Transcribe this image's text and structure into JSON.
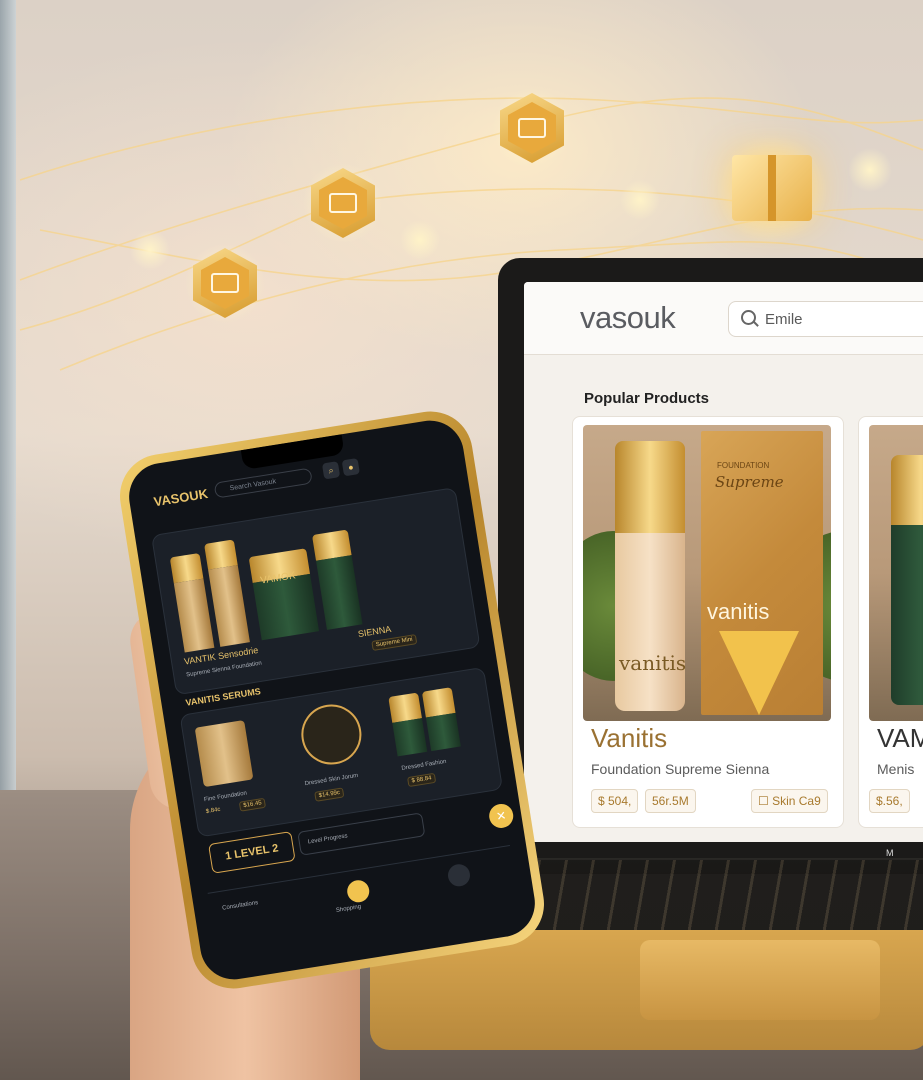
{
  "scene": {
    "icons": [
      "mail-icon",
      "mail-icon",
      "card-icon",
      "gift-icon"
    ],
    "accent": "#d8a64f"
  },
  "laptop": {
    "logo": "vasouk",
    "search_placeholder": "Emile",
    "section_title": "Popular Products",
    "corner_label": "M",
    "cards": [
      {
        "name": "Vanitis",
        "subtitle": "Foundation Supreme Sienna",
        "bottle_label": "vanitis",
        "box_brand": "vanitis",
        "box_top": "FOUNDATION",
        "box_script": "Supreme",
        "chips": [
          "$ 504,",
          "56r.5M",
          "☐ Skin Ca9"
        ]
      },
      {
        "name": "VAM",
        "subtitle": "Menis",
        "chips": [
          "$.56,"
        ]
      }
    ]
  },
  "phone": {
    "logo": "VASOUK",
    "search_placeholder": "Search Vasouk",
    "product_name": "VANTIK Sensodrie",
    "product_tag": "SIENNA",
    "product_sub": "Supreme Sienna Foundation",
    "product_chip": "Supreme Mini",
    "bottle_label": "VAMOK",
    "section_title": "VANITIS SERUMS",
    "items": [
      {
        "name": "Fine Foundation",
        "price": "$.84c",
        "chip": "$16.45"
      },
      {
        "name": "Dressed Skin Jorum",
        "chip": "$14.99c"
      },
      {
        "name": "Dressed Fashion",
        "chip": "$ 88.84"
      }
    ],
    "level": "1 LEVEL 2",
    "level_bar": "Level Progress",
    "nav": [
      "Consultations",
      "Shopping"
    ]
  }
}
